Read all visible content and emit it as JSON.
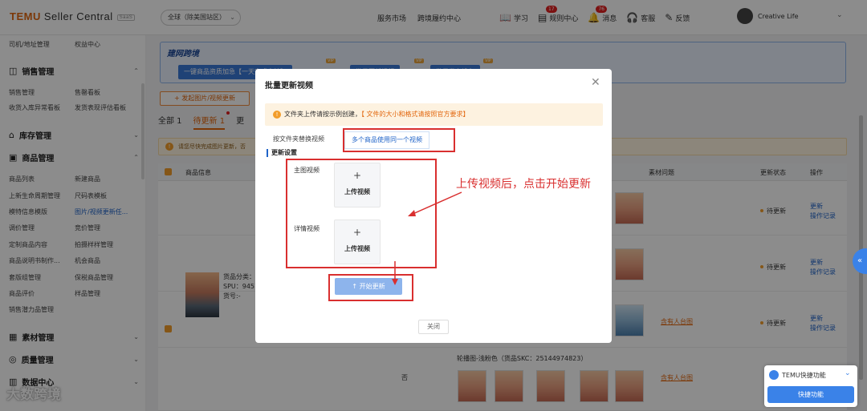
{
  "topbar": {
    "logo": "TEMU",
    "product": "Seller Central",
    "logo_badge": "SaaS",
    "region": "全球（除美国站区）",
    "nav": [
      "服务市场",
      "跨境履约中心"
    ],
    "icons": [
      {
        "label": "学习",
        "icon": "book-icon"
      },
      {
        "label": "规则中心",
        "icon": "rules-icon",
        "badge": "17"
      },
      {
        "label": "消息",
        "icon": "bell-icon",
        "badge": "76"
      },
      {
        "label": "客服",
        "icon": "headset-icon"
      },
      {
        "label": "反馈",
        "icon": "feedback-icon"
      }
    ],
    "user": "Creative Life"
  },
  "sidebar": {
    "pair_top": [
      "司机/地址管理",
      "权益中心"
    ],
    "groups": [
      {
        "label": "销售管理",
        "icon": "sales-icon"
      },
      {
        "label": "库存管理",
        "icon": "inventory-icon"
      },
      {
        "label": "商品管理",
        "icon": "goods-icon"
      },
      {
        "label": "素材管理",
        "icon": "material-icon"
      },
      {
        "label": "质量管理",
        "icon": "quality-icon"
      },
      {
        "label": "数据中心",
        "icon": "data-icon"
      }
    ],
    "sales_items": [
      [
        "销售管理",
        "售罄看板"
      ],
      [
        "收货入库异常看板",
        "发货表现评估看板"
      ]
    ],
    "goods_items": [
      [
        "商品列表",
        "新建商品"
      ],
      [
        "上新生命周期管理",
        "尺码表模板"
      ],
      [
        "模特信息模版",
        "图片/视频更新任..."
      ],
      [
        "调价管理",
        "竞价管理"
      ],
      [
        "定制商品内容",
        "拍摄样样管理"
      ],
      [
        "商品说明书制作...",
        "机会商品"
      ],
      [
        "套版组管理",
        "保税商品管理"
      ],
      [
        "商品评价",
        "样品管理"
      ],
      [
        "销售潜力品管理",
        ""
      ]
    ],
    "watermark": "大数跨境"
  },
  "main": {
    "promo_title": "建网跨境",
    "promo_buttons": [
      "一键商品资质加急【一天完成审核】",
      "批量更新视频",
      "批量发布设备"
    ],
    "vip": "VIP",
    "add_button": "+ 发起图片/视频更新",
    "tabs": [
      "全部 1",
      "待更新 1",
      "更"
    ],
    "warning": "请您尽快完成图片更新，否",
    "table_headers": [
      "商品信息",
      "素材问题",
      "更新状态",
      "操作"
    ],
    "status": "待更新",
    "op_update": "更新",
    "op_log": "操作记录",
    "product_title": "货品分类：",
    "product_spu": "SPU：9451",
    "product_no": "货号:-",
    "manual_check": "含有人台图",
    "sku_line": "轮播图-浅粉色（货品SKC：25144974823）",
    "row_note": "否"
  },
  "modal": {
    "title": "批量更新视频",
    "tip": "文件夹上传请按示例创建，",
    "tip_highlight": "【 文件的大小和格式请按照官方要求】",
    "tab_folder": "按文件夹替换视频",
    "tab_same": "多个商品使用同一个视频",
    "section": "更新设置",
    "main_video_label": "主图视频",
    "detail_video_label": "详情视频",
    "plus": "+",
    "upload_label": "上传视频",
    "start_button": "开始更新",
    "close_button": "关闭"
  },
  "annotation": "上传视频后，点击开始更新",
  "quick": {
    "title": "TEMU快捷功能",
    "button": "快捷功能"
  },
  "colors": {
    "brand": "#e2670e",
    "primary": "#1f63c8",
    "annotation": "#d92f2f"
  }
}
